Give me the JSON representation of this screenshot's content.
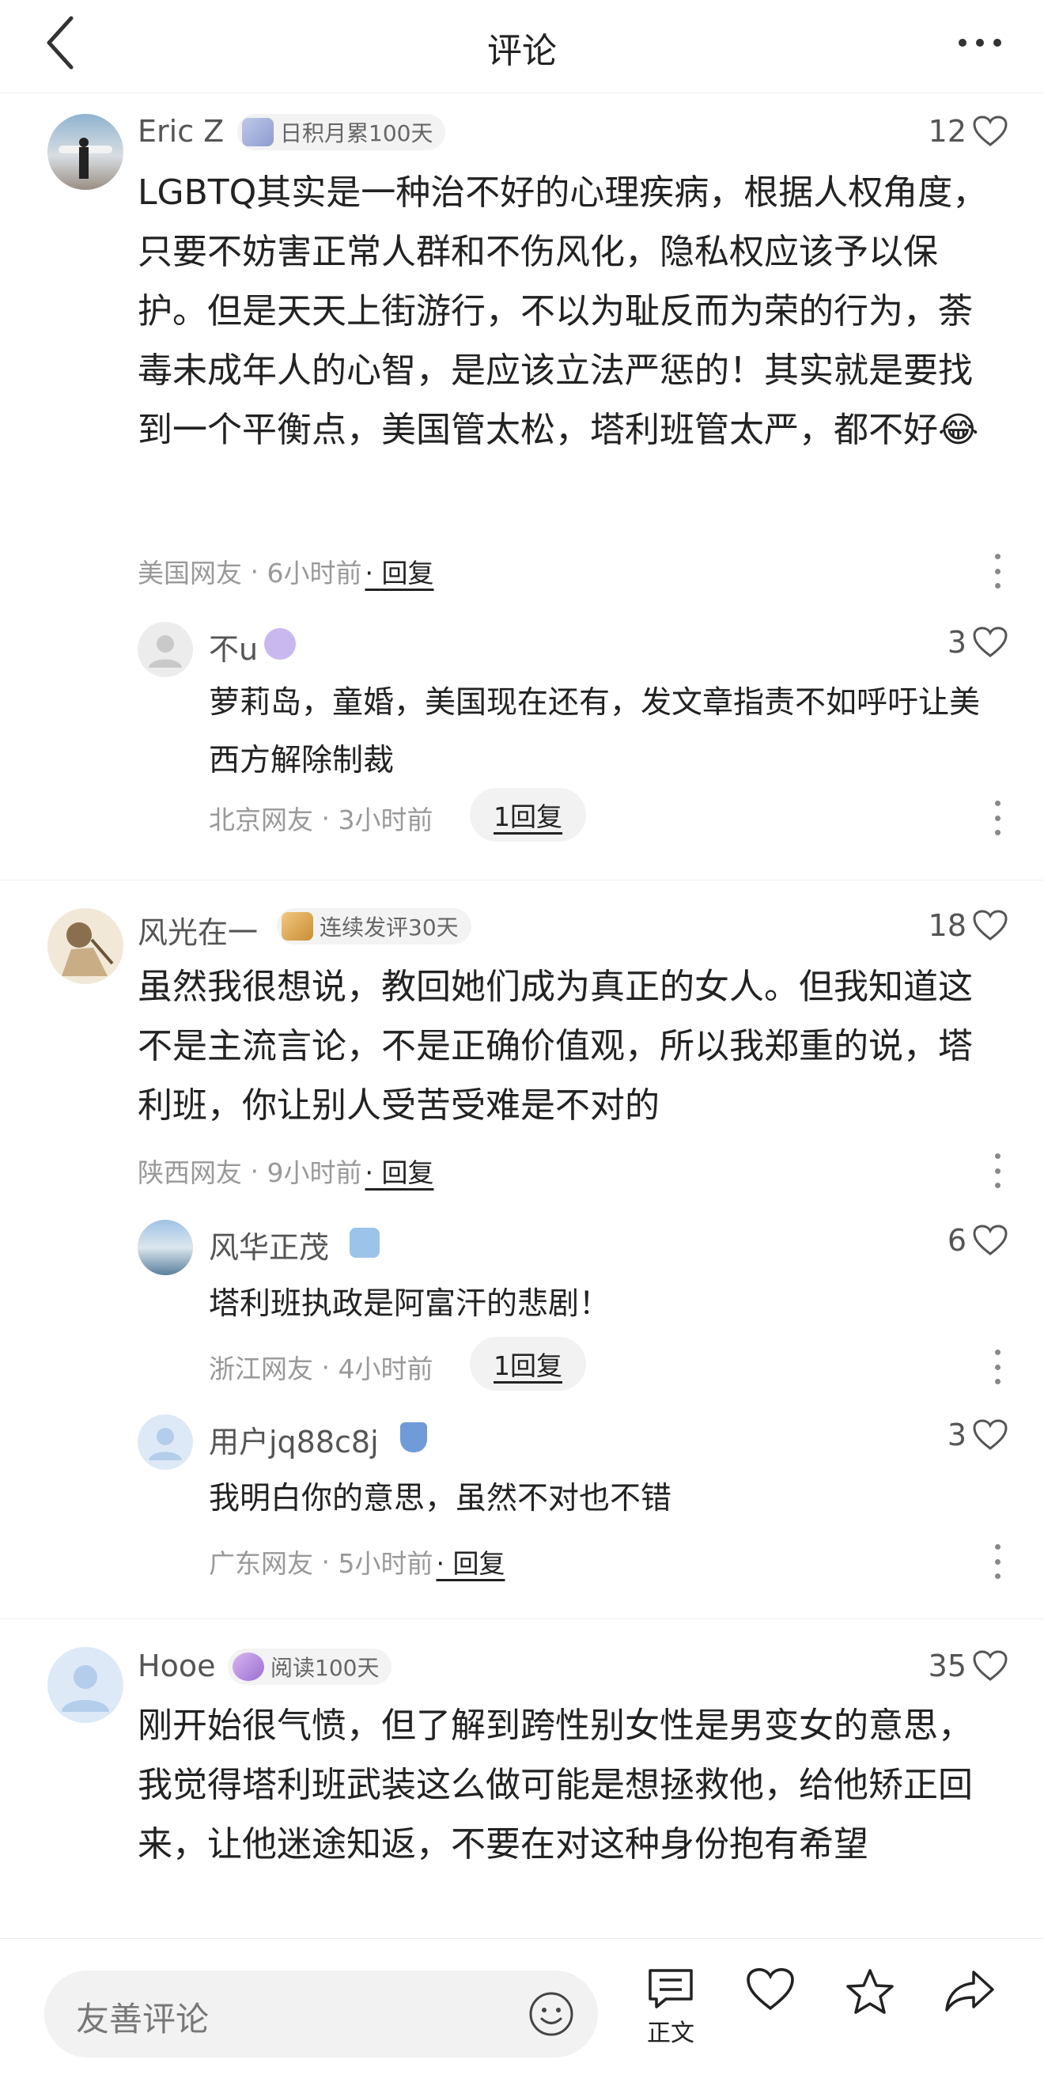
{
  "header": {
    "title": "评论"
  },
  "comments": [
    {
      "user": "Eric Z",
      "badge": "日积月累100天",
      "likes": "12",
      "text": "LGBTQ其实是一种治不好的心理疾病，根据人权角度，只要不妨害正常人群和不伤风化，隐私权应该予以保护。但是天天上街游行，不以为耻反而为荣的行为，荼毒未成年人的心智，是应该立法严惩的！其实就是要找到一个平衡点，美国管太松，塔利班管太严，都不好😂",
      "location": "美国网友",
      "time": "6小时前",
      "reply_label": "· 回复",
      "replies": [
        {
          "user": "不u",
          "likes": "3",
          "text": "萝莉岛，童婚，美国现在还有，发文章指责不如呼吁让美西方解除制裁",
          "location": "北京网友",
          "time": "3小时前",
          "reply_count_label": "1回复"
        }
      ]
    },
    {
      "user": "风光在一",
      "badge": "连续发评30天",
      "likes": "18",
      "text": "虽然我很想说，教回她们成为真正的女人。但我知道这不是主流言论，不是正确价值观，所以我郑重的说，塔利班，你让别人受苦受难是不对的",
      "location": "陕西网友",
      "time": "9小时前",
      "reply_label": "· 回复",
      "replies": [
        {
          "user": "风华正茂",
          "likes": "6",
          "text": "塔利班执政是阿富汗的悲剧！",
          "location": "浙江网友",
          "time": "4小时前",
          "reply_count_label": "1回复"
        },
        {
          "user": "用户jq88c8j",
          "likes": "3",
          "text": "我明白你的意思，虽然不对也不错",
          "location": "广东网友",
          "time": "5小时前",
          "reply_label": "· 回复"
        }
      ]
    },
    {
      "user": "Hooe",
      "badge": "阅读100天",
      "likes": "35",
      "text": "刚开始很气愤，但了解到跨性别女性是男变女的意思，我觉得塔利班武装这么做可能是想拯救他，给他矫正回来，让他迷途知返，不要在对这种身份抱有希望"
    }
  ],
  "bottom_bar": {
    "input_placeholder": "友善评论",
    "article_label": "正文"
  },
  "icons": [
    "back-icon",
    "more-icon",
    "heart-icon",
    "ellipsis-vertical-icon",
    "emoji-icon",
    "article-icon",
    "like-icon",
    "star-icon",
    "share-icon"
  ],
  "colors": {
    "text": "#222222",
    "meta": "#999999",
    "pill_bg": "#f2f2f2"
  }
}
